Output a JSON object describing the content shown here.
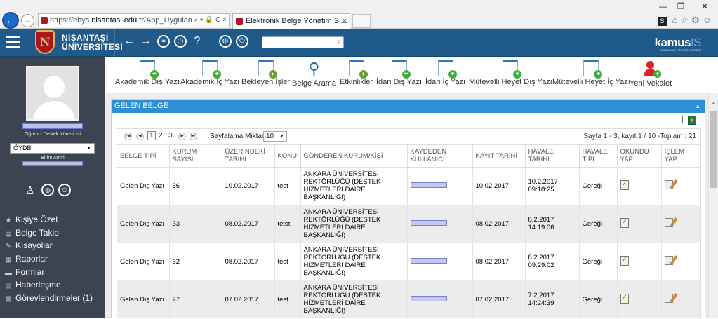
{
  "browser": {
    "url_prefix": "https://ebys.",
    "url_domain": "nisantasi.edu.tr",
    "url_suffix": "/App_Uygulama/Anasa",
    "addr_icons": "⌕ ▾ 🔒 C ×",
    "tab_title": "Elektronik Belge Yönetim Si...",
    "tab_close": "×",
    "win_minimize": "—",
    "win_restore": "❐",
    "win_close": "✕",
    "tools_badge": "S"
  },
  "app": {
    "logo_letter": "N",
    "university_line1": "NİŞANTAŞI",
    "university_line2": "ÜNİVERSİTESİ",
    "brand": "kamus",
    "brand_suffix": "IS",
    "brand_tagline": "KURUMSAL YÖNETİM SİSTEMİ"
  },
  "user": {
    "role": "Öğrenci Destek Yöneticisi",
    "unit": "ÖYDB",
    "unit_role": "Birim Amiri"
  },
  "sidebar": {
    "items": [
      {
        "label": "Kişiye Özel",
        "icon": "star-icon",
        "glyph": "★"
      },
      {
        "label": "Belge Takip",
        "icon": "document-icon",
        "glyph": "▤"
      },
      {
        "label": "Kısayollar",
        "icon": "pencil-icon",
        "glyph": "✎"
      },
      {
        "label": "Raporlar",
        "icon": "report-icon",
        "glyph": "▦"
      },
      {
        "label": "Formlar",
        "icon": "form-icon",
        "glyph": "▬"
      },
      {
        "label": "Haberleşme",
        "icon": "news-icon",
        "glyph": "▤"
      },
      {
        "label": "Görevlendirmeler (1)",
        "icon": "assign-icon",
        "glyph": "▤"
      }
    ]
  },
  "toolbar": {
    "buttons": [
      {
        "label": "Akademik Dış Yazı"
      },
      {
        "label": "Akademik İç Yazı"
      },
      {
        "label": "Bekleyen İşler"
      },
      {
        "label": "Belge Arama"
      },
      {
        "label": "Etkinlikler"
      },
      {
        "label": "İdari Dış Yazı"
      },
      {
        "label": "İdari İç Yazı"
      },
      {
        "label": "Mütevelli Heyet Dış Yazı"
      },
      {
        "label": "Mütevelli Heyet İç Yazı"
      },
      {
        "label": "Yeni Vekalet"
      }
    ]
  },
  "panel": {
    "title": "GELEN BELGE",
    "pager": {
      "pages": [
        "1",
        "2",
        "3"
      ],
      "page_size_label": "Sayfalama Miktarı:",
      "page_size": "10",
      "info": "Sayfa 1 - 3, kayıt 1 / 10 -Toplam : 21"
    },
    "columns": [
      "BELGE TİPİ",
      "KURUM SAYISI",
      "ÜZERİNDEKİ TARİHİ",
      "KONU",
      "GÖNDEREN KURUM/KİŞİ",
      "KAYDEDEN KULLANICI",
      "KAYIT TARİHİ",
      "HAVALE TARİHİ",
      "HAVALE TİPİ",
      "OKUNDU YAP",
      "İŞLEM YAP"
    ],
    "rows": [
      {
        "tip": "Gelen Dış Yazı",
        "sayi": "36",
        "tarih": "10.02.2017",
        "konu": "test",
        "gonderen": "ANKARA ÜNİVERSİTESİ REKTÖRLÜĞÜ (DESTEK HİZMETLERİ DAİRE BAŞKANLIĞI)",
        "kayit": "10.02.2017",
        "havale_tarih": "10.2.2017",
        "havale_saat": "09:18:25",
        "havale_tipi": "Gereği"
      },
      {
        "tip": "Gelen Dış Yazı",
        "sayi": "33",
        "tarih": "08.02.2017",
        "konu": "tetst",
        "gonderen": "ANKARA ÜNİVERSİTESİ REKTÖRLÜĞÜ (DESTEK HİZMETLERİ DAİRE BAŞKANLIĞI)",
        "kayit": "08.02.2017",
        "havale_tarih": "8.2.2017",
        "havale_saat": "14:19:06",
        "havale_tipi": "Gereği"
      },
      {
        "tip": "Gelen Dış Yazı",
        "sayi": "32",
        "tarih": "08.02.2017",
        "konu": "test",
        "gonderen": "ANKARA ÜNİVERSİTESİ REKTÖRLÜĞÜ (DESTEK HİZMETLERİ DAİRE BAŞKANLIĞI)",
        "kayit": "08.02.2017",
        "havale_tarih": "8.2.2017",
        "havale_saat": "09:29:02",
        "havale_tipi": "Gereği"
      },
      {
        "tip": "Gelen Dış Yazı",
        "sayi": "27",
        "tarih": "07.02.2017",
        "konu": "test",
        "gonderen": "ANKARA ÜNİVERSİTESİ REKTÖRLÜĞÜ (DESTEK HİZMETLERİ DAİRE BAŞKANLIĞI)",
        "kayit": "07.02.2017",
        "havale_tarih": "7.2.2017",
        "havale_saat": "14:24:39",
        "havale_tipi": "Gereği"
      }
    ]
  }
}
